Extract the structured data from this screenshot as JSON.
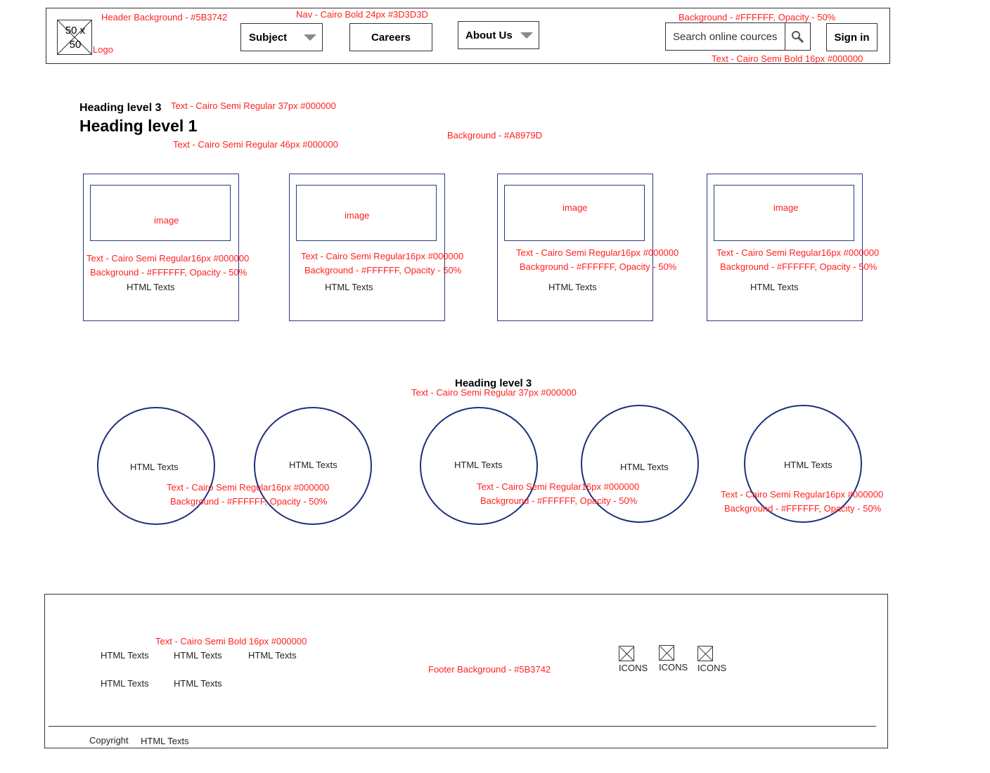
{
  "header": {
    "logo_text": "50 x 50",
    "logo_label": "Logo",
    "header_bg_note": "Header Background - #5B3742",
    "nav_note": "Nav - Cairo Bold 24px #3D3D3D",
    "search_bg_note": "Background - #FFFFFF, Opacity - 50%",
    "nav": {
      "subject": "Subject",
      "careers": "Careers",
      "about": "About Us"
    },
    "search_placeholder": "Search online cources",
    "signin": "Sign in",
    "text_note": "Text - Cairo Semi Bold 16px #000000"
  },
  "hero": {
    "h3": "Heading level 3",
    "h3_note": "Text - Cairo Semi Regular 37px #000000",
    "h1": "Heading level 1",
    "h1_note": "Text - Cairo Semi Regular 46px #000000",
    "bg_note": "Background - #A8979D"
  },
  "cards": [
    {
      "image": "image",
      "text_note": "Text - Cairo Semi Regular16px #000000",
      "bg_note": "Background - #FFFFFF, Opacity - 50%",
      "label": "HTML Texts"
    },
    {
      "image": "image",
      "text_note": "Text - Cairo Semi Regular16px #000000",
      "bg_note": "Background - #FFFFFF, Opacity - 50%",
      "label": "HTML Texts"
    },
    {
      "image": "image",
      "text_note": "Text - Cairo Semi Regular16px #000000",
      "bg_note": "Background - #FFFFFF, Opacity - 50%",
      "label": "HTML Texts"
    },
    {
      "image": "image",
      "text_note": "Text - Cairo Semi Regular16px #000000",
      "bg_note": "Background - #FFFFFF, Opacity - 50%",
      "label": "HTML Texts"
    }
  ],
  "section2": {
    "heading": "Heading level 3",
    "heading_note": "Text - Cairo Semi Regular 37px #000000",
    "circles": [
      "HTML Texts",
      "HTML Texts",
      "HTML Texts",
      "HTML Texts",
      "HTML Texts"
    ],
    "notes": [
      {
        "text": "Text - Cairo Semi Regular16px #000000",
        "bg": "Background - #FFFFFF, Opacity - 50%"
      },
      {
        "text": "Text - Cairo Semi Regular16px #000000",
        "bg": "Background - #FFFFFF, Opacity - 50%"
      },
      {
        "text": "Text - Cairo Semi Regular16px #000000",
        "bg": "Background - #FFFFFF, Opacity - 50%"
      }
    ]
  },
  "footer": {
    "text_note": "Text - Cairo Semi Bold 16px #000000",
    "links": [
      "HTML Texts",
      "HTML Texts",
      "HTML Texts",
      "HTML Texts",
      "HTML Texts"
    ],
    "bg_note": "Footer Background - #5B3742",
    "icons": [
      "ICONS",
      "ICONS",
      "ICONS"
    ],
    "copyright": "Copyright",
    "copyright_text": "HTML Texts"
  },
  "colors": {
    "annotation": "#ff2020",
    "outline": "#2a3a80"
  }
}
